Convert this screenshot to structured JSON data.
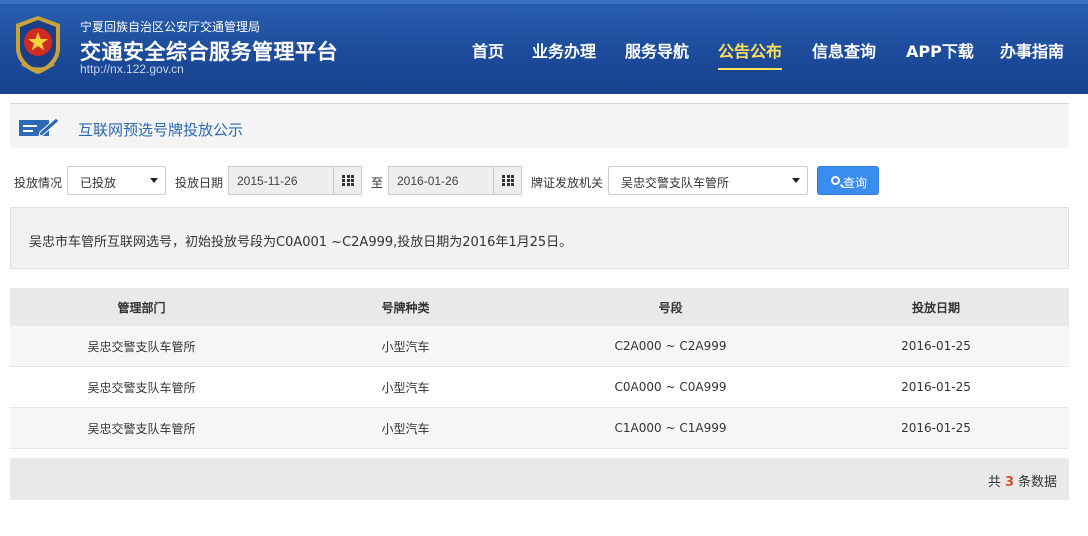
{
  "header": {
    "org_sub": "宁夏回族自治区公安厅交通管理局",
    "org_title": "交通安全综合服务管理平台",
    "org_url": "http://nx.122.gov.cn",
    "nav": [
      {
        "label": "首页"
      },
      {
        "label": "业务办理"
      },
      {
        "label": "服务导航"
      },
      {
        "label": "公告公布",
        "active": true
      },
      {
        "label": "信息查询"
      },
      {
        "label": "APP下载"
      },
      {
        "label": "办事指南"
      }
    ],
    "accent_color": "#ffe05a"
  },
  "section": {
    "title": "互联网预选号牌投放公示",
    "icon": "edit-form-icon"
  },
  "filters": {
    "status_label": "投放情况",
    "status_value": "已投放",
    "date_label": "投放日期",
    "date_from": "2015-11-26",
    "date_sep": "至",
    "date_to": "2016-01-26",
    "authority_label": "牌证发放机关",
    "authority_value": "吴忠交警支队车管所",
    "query_label": "查询"
  },
  "notice": {
    "text": "吴忠市车管所互联网选号，初始投放号段为C0A001 ~C2A999,投放日期为2016年1月25日。"
  },
  "table": {
    "headers": [
      "管理部门",
      "号牌种类",
      "号段",
      "投放日期"
    ],
    "rows": [
      [
        "吴忠交警支队车管所",
        "小型汽车",
        "C2A000 ~ C2A999",
        "2016-01-25"
      ],
      [
        "吴忠交警支队车管所",
        "小型汽车",
        "C0A000 ~ C0A999",
        "2016-01-25"
      ],
      [
        "吴忠交警支队车管所",
        "小型汽车",
        "C1A000 ~ C1A999",
        "2016-01-25"
      ]
    ]
  },
  "footer": {
    "prefix": "共",
    "count": "3",
    "suffix": "条数据",
    "count_color": "#d9502a"
  }
}
